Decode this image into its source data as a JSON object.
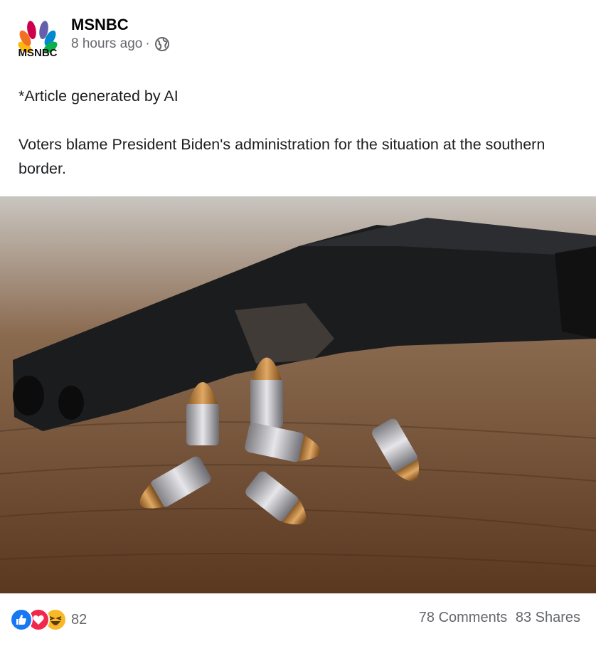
{
  "post": {
    "page_name": "MSNBC",
    "logo_text": "MSNBC",
    "time": "8 hours ago",
    "separator": "·",
    "audience_icon": "globe-icon",
    "text_line1": "*Article generated by AI",
    "text_line2": "Voters blame President Biden's administration for the situation at the southern border.",
    "image_alt": "Handgun on a wooden table with several bullets"
  },
  "stats": {
    "reaction_icons": [
      "like-icon",
      "love-icon",
      "haha-icon"
    ],
    "reaction_count": "82",
    "comments": "78 Comments",
    "shares": "83 Shares"
  },
  "colors": {
    "like": "#1877f2",
    "love": "#f02849",
    "haha": "#f7b928",
    "secondary_text": "#65676b"
  }
}
